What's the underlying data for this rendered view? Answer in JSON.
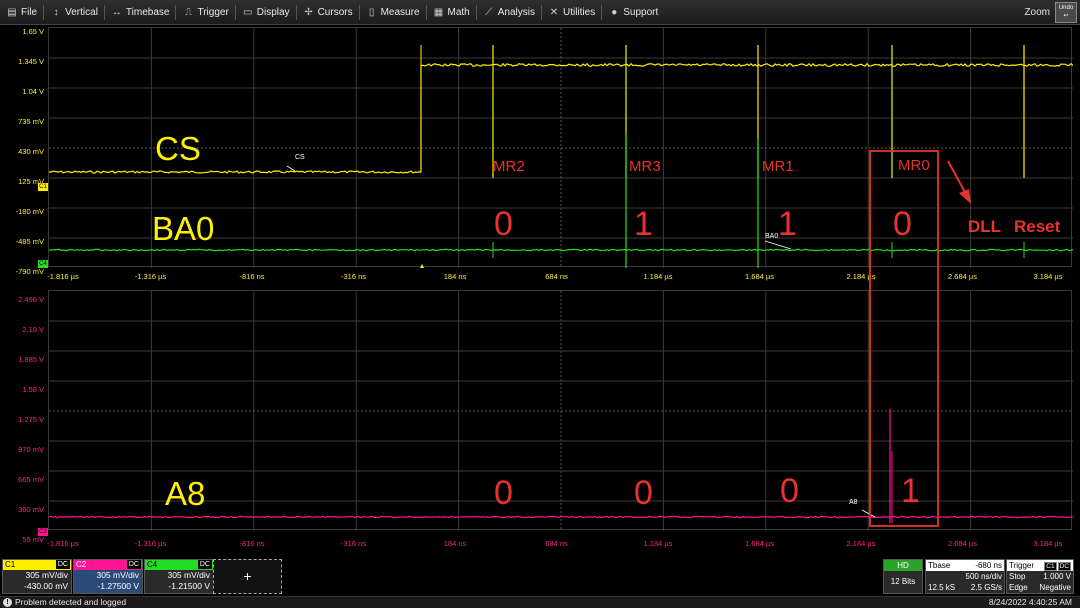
{
  "menu": {
    "items": [
      {
        "label": "File",
        "icon": "file-icon",
        "glyph": "▤"
      },
      {
        "label": "Vertical",
        "icon": "vertical-arrows-icon",
        "glyph": "↕"
      },
      {
        "label": "Timebase",
        "icon": "horizontal-arrows-icon",
        "glyph": "↔"
      },
      {
        "label": "Trigger",
        "icon": "trigger-icon",
        "glyph": "⎍"
      },
      {
        "label": "Display",
        "icon": "display-icon",
        "glyph": "▭"
      },
      {
        "label": "Cursors",
        "icon": "cursors-icon",
        "glyph": "✢"
      },
      {
        "label": "Measure",
        "icon": "measure-icon",
        "glyph": "▯"
      },
      {
        "label": "Math",
        "icon": "math-icon",
        "glyph": "▦"
      },
      {
        "label": "Analysis",
        "icon": "analysis-icon",
        "glyph": "⟋"
      },
      {
        "label": "Utilities",
        "icon": "utilities-icon",
        "glyph": "✕"
      },
      {
        "label": "Support",
        "icon": "support-icon",
        "glyph": "●"
      }
    ],
    "zoom_label": "Zoom",
    "undo_label": "Undo"
  },
  "top_grid": {
    "y_labels": [
      "1.65 V",
      "1.345 V",
      "1.04 V",
      "735 mV",
      "430 mV",
      "125 mV",
      "-180 mV",
      "-485 mV",
      "-790 mV"
    ],
    "x_labels": [
      "-1.816 µs",
      "-1.316 µs",
      "-816 ns",
      "-316 ns",
      "184 ns",
      "684 ns",
      "1.184 µs",
      "1.684 µs",
      "2.184 µs",
      "2.684 µs",
      "3.184 µs"
    ]
  },
  "bottom_grid": {
    "y_labels": [
      "2.496 V",
      "2.19 V",
      "1.885 V",
      "1.58 V",
      "1.275 V",
      "970 mV",
      "665 mV",
      "360 mV",
      "55 mV"
    ],
    "x_labels": [
      "-1.816 µs",
      "-1.316 µs",
      "-816 ns",
      "-316 ns",
      "184 ns",
      "684 ns",
      "1.184 µs",
      "1.684 µs",
      "2.184 µs",
      "2.684 µs",
      "3.184 µs"
    ]
  },
  "annotations": {
    "cs": "CS",
    "ba0": "BA0",
    "a8": "A8",
    "mr_labels": [
      "MR2",
      "MR3",
      "MR1",
      "MR0"
    ],
    "ba0_bits": [
      "0",
      "1",
      "1",
      "0"
    ],
    "a8_bits": [
      "0",
      "0",
      "0",
      "1"
    ],
    "dll": "DLL",
    "reset": "Reset",
    "tag_cs": "CS",
    "tag_ba0": "BA0",
    "tag_a8": "A8"
  },
  "channels": [
    {
      "name": "C1",
      "coupling": "DC",
      "scale": "305 mV/div",
      "offset": "-430.00 mV",
      "color": "#ffee00"
    },
    {
      "name": "C2",
      "coupling": "DC",
      "scale": "305 mV/div",
      "offset": "-1.27500 V",
      "color": "#ff1493"
    },
    {
      "name": "C4",
      "coupling": "DC",
      "scale": "305 mV/div",
      "offset": "-1.21500 V",
      "color": "#22dd22"
    }
  ],
  "add_label": "+",
  "hd": {
    "badge": "HD",
    "bits": "12 Bits"
  },
  "timebase": {
    "label": "Tbase",
    "delay": "-680 ns",
    "per_div": "500 ns/div",
    "samples": "12.5 kS",
    "rate": "2.5 GS/s"
  },
  "trigger": {
    "label": "Trigger",
    "c1": "C1",
    "dc": "DC",
    "mode": "Stop",
    "level": "1.000 V",
    "type": "Edge",
    "slope": "Negative"
  },
  "status": {
    "message": "Problem detected and logged",
    "timestamp": "8/24/2022 4:40:25 AM"
  },
  "colors": {
    "yellow": "#ffee00",
    "green": "#22dd22",
    "magenta": "#ff1493",
    "annotation_red": "#e8322e"
  }
}
